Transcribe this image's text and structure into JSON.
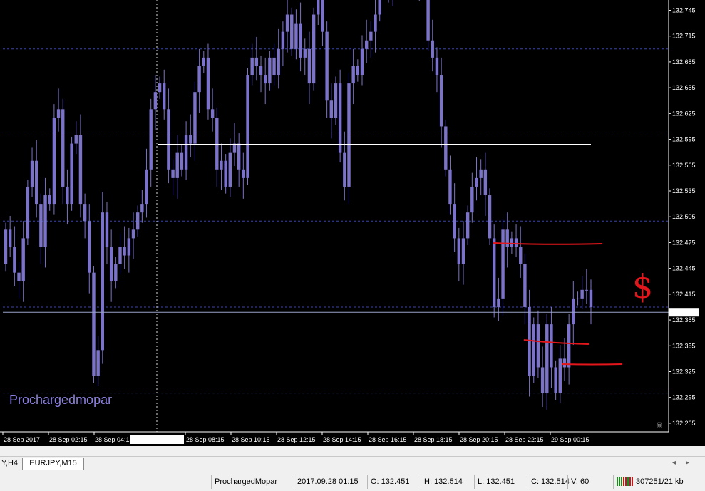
{
  "chart": {
    "symbol": "EURJPY",
    "timeframe": "M15",
    "watermark": "Prochargedmopar",
    "current_price": "132.394",
    "crosshair_time": "2017.09.28 07:00",
    "y_min": 132.255,
    "y_max": 132.757,
    "price_ticks": [
      "132.745",
      "132.715",
      "132.685",
      "132.655",
      "132.625",
      "132.595",
      "132.565",
      "132.535",
      "132.505",
      "132.475",
      "132.445",
      "132.415",
      "132.385",
      "132.355",
      "132.325",
      "132.295",
      "132.265"
    ],
    "time_labels": [
      "28 Sep 2017",
      "28 Sep 02:15",
      "28 Sep 04:15",
      "28 Sep 08:15",
      "28 Sep 10:15",
      "28 Sep 12:15",
      "28 Sep 14:15",
      "28 Sep 16:15",
      "28 Sep 18:15",
      "28 Sep 20:15",
      "28 Sep 22:15",
      "29 Sep 00:15"
    ],
    "colors": {
      "background": "#000000",
      "candle": "#7b73c9",
      "doji": "#3fc23f",
      "grid": "#3b44a8",
      "level_line": "#ffffff",
      "annotation": "#e3161b",
      "watermark": "#8a7fe0"
    },
    "annotation_symbol": "$",
    "icons": [
      "skull-icon"
    ]
  },
  "tabs": [
    {
      "label": "Y,H4"
    },
    {
      "label": "EURJPY,M15"
    }
  ],
  "tab_nav": [
    "◂",
    "▸"
  ],
  "status": {
    "profile": "ProchargedMopar",
    "datetime": "2017.09.28 01:15",
    "open": "O: 132.451",
    "high": "H: 132.514",
    "low": "L: 132.451",
    "close": "C: 132.514",
    "volume": "V: 60",
    "traffic": "307251/21 kb"
  }
}
